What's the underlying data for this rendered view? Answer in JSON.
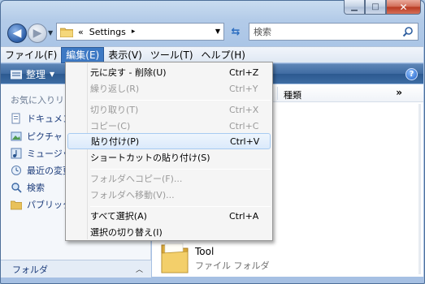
{
  "window": {
    "caption": {
      "min": "▁",
      "max": "□",
      "close": "✕"
    }
  },
  "nav": {
    "back_glyph": "◀",
    "forward_glyph": "▶",
    "address": {
      "prefix": "«",
      "crumb": "Settings",
      "sep": "▸"
    },
    "search_placeholder": "検索"
  },
  "menubar": [
    {
      "label": "ファイル(F)",
      "active": false
    },
    {
      "label": "編集(E)",
      "active": true
    },
    {
      "label": "表示(V)",
      "active": false
    },
    {
      "label": "ツール(T)",
      "active": false
    },
    {
      "label": "ヘルプ(H)",
      "active": false
    }
  ],
  "toolbar": {
    "organize": "整理",
    "help": "?"
  },
  "navpane": {
    "favorites_heading": "お気に入りリ",
    "items": [
      {
        "label": "ドキュメン",
        "icon": "documents-icon"
      },
      {
        "label": "ピクチャ",
        "icon": "pictures-icon"
      },
      {
        "label": "ミュージッ",
        "icon": "music-icon"
      },
      {
        "label": "最近の変更",
        "icon": "recent-icon"
      },
      {
        "label": "検索",
        "icon": "search-folder-icon"
      },
      {
        "label": "パブリック",
        "icon": "public-folder-icon"
      }
    ],
    "folders_label": "フォルダ",
    "folders_chevron": "︿"
  },
  "content": {
    "column_kind": "種類",
    "more": "»",
    "file": {
      "name": "Tool",
      "type": "ファイル フォルダ"
    }
  },
  "edit_menu": [
    {
      "label": "元に戻す - 削除(U)",
      "shortcut": "Ctrl+Z",
      "disabled": false
    },
    {
      "label": "繰り返し(R)",
      "shortcut": "Ctrl+Y",
      "disabled": true
    },
    {
      "separator": true
    },
    {
      "label": "切り取り(T)",
      "shortcut": "Ctrl+X",
      "disabled": true
    },
    {
      "label": "コピー(C)",
      "shortcut": "Ctrl+C",
      "disabled": true
    },
    {
      "label": "貼り付け(P)",
      "shortcut": "Ctrl+V",
      "disabled": false,
      "hover": true
    },
    {
      "label": "ショートカットの貼り付け(S)",
      "shortcut": "",
      "disabled": false
    },
    {
      "separator": true
    },
    {
      "label": "フォルダへコピー(F)...",
      "shortcut": "",
      "disabled": true
    },
    {
      "label": "フォルダへ移動(V)...",
      "shortcut": "",
      "disabled": true
    },
    {
      "separator": true
    },
    {
      "label": "すべて選択(A)",
      "shortcut": "Ctrl+A",
      "disabled": false
    },
    {
      "label": "選択の切り替え(I)",
      "shortcut": "",
      "disabled": false
    }
  ],
  "colors": {
    "menu_active": "#3d79c4",
    "toolbar": "#3f6ba2",
    "hover_border": "#a8cbf1"
  }
}
